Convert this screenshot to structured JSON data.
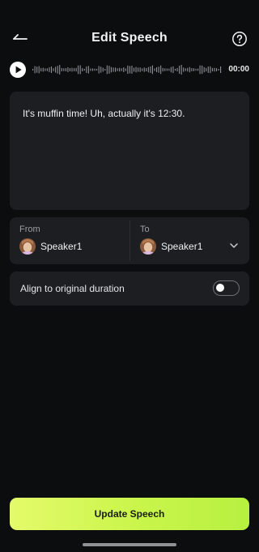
{
  "header": {
    "title": "Edit Speech",
    "back_icon": "back-arrow-icon",
    "help_icon": "help-circle-icon"
  },
  "player": {
    "time": "00:00",
    "play_icon": "play-icon"
  },
  "speech": {
    "text": "It's muffin time! Uh, actually it's 12:30."
  },
  "speakers": {
    "from_label": "From",
    "from_speaker": "Speaker1",
    "to_label": "To",
    "to_speaker": "Speaker1",
    "dropdown_icon": "chevron-down-icon"
  },
  "align": {
    "label": "Align to original duration",
    "enabled": false
  },
  "footer": {
    "update_label": "Update Speech"
  },
  "colors": {
    "background": "#0c0d0f",
    "card": "#1c1e22",
    "accent_start": "#e4fa6a",
    "accent_end": "#b7f040"
  }
}
